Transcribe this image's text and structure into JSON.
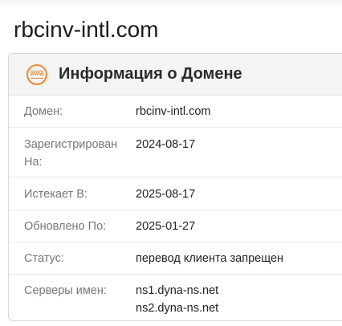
{
  "page": {
    "title": "rbcinv-intl.com"
  },
  "card": {
    "title": "Информация о Домене",
    "icon": "www-globe-icon",
    "icon_text": "www",
    "accent_color": "#e8893a"
  },
  "rows": [
    {
      "label": "Домен:",
      "values": [
        "rbcinv-intl.com"
      ]
    },
    {
      "label": "Зарегистрирован На:",
      "values": [
        "2024-08-17"
      ]
    },
    {
      "label": "Истекает В:",
      "values": [
        "2025-08-17"
      ]
    },
    {
      "label": "Обновлено По:",
      "values": [
        "2025-01-27"
      ]
    },
    {
      "label": "Статус:",
      "values": [
        "перевод клиента запрещен"
      ]
    },
    {
      "label": "Серверы имен:",
      "values": [
        "ns1.dyna-ns.net",
        "ns2.dyna-ns.net"
      ]
    }
  ]
}
